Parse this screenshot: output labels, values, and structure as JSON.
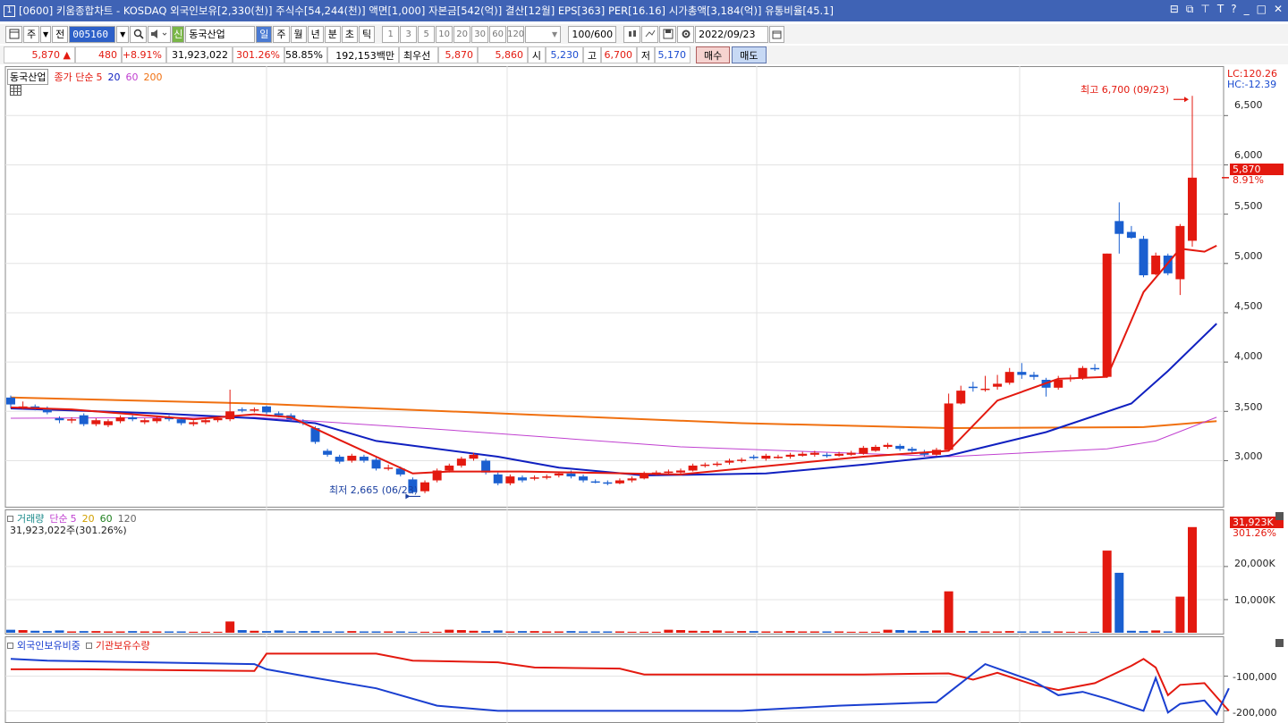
{
  "titlebar": {
    "window_number": "1",
    "text": "[0600] 키움종합차트 - KOSDAQ 외국인보유[2,330(천)] 주식수[54,244(천)] 액면[1,000] 자본금[542(억)] 결산[12월] EPS[363] PER[16.16] 시가총액[3,184(억)] 유통비율[45.1]",
    "controls": [
      "⊟",
      "⧉",
      "⊤",
      "T",
      "?",
      "_",
      "□",
      "✕"
    ]
  },
  "toolbar": {
    "period_type": "주",
    "all": "전",
    "stock_code": "005160",
    "shin": "신",
    "stock_name": "동국산업",
    "periods": [
      "일",
      "주",
      "월",
      "년",
      "분",
      "초",
      "틱"
    ],
    "active_period": "일",
    "intervals": [
      "1",
      "3",
      "5",
      "10",
      "20",
      "30",
      "60",
      "120"
    ],
    "counter": "100/600",
    "date": "2022/09/23"
  },
  "quote": {
    "price": "5,870",
    "arrow": "▲",
    "change": "480",
    "change_pct": "+8.91%",
    "volume": "31,923,022",
    "volume_ratio": "301.26%",
    "turnover_ratio": "58.85%",
    "amount": "192,153백만",
    "priority_label": "최우선",
    "ask": "5,870",
    "bid": "5,860",
    "open_label": "시",
    "open": "5,230",
    "high_label": "고",
    "high": "6,700",
    "low_label": "저",
    "low": "5,170",
    "buy_label": "매수",
    "sell_label": "매도"
  },
  "colors": {
    "up": "#e3190f",
    "down": "#1a5fd0",
    "ma5": "#e3190f",
    "ma20": "#1020c0",
    "ma60": "#c040d0",
    "ma200": "#f07010",
    "foreign": "#1a3fd0",
    "institution": "#e3190f"
  },
  "price_panel": {
    "stock_tag": "동국산업",
    "legend": {
      "label": "종가 단순",
      "p1": "5",
      "p2": "20",
      "p3": "60",
      "p4": "200"
    },
    "lc": "LC:120.26",
    "hc": "HC:-12.39",
    "high_annotation": "최고 6,700 (09/23)",
    "low_annotation": "최저 2,665 (06/23)",
    "current_price": "5,870",
    "current_pct": "8.91%",
    "y_ticks": [
      "6,500",
      "6,000",
      "5,500",
      "5,000",
      "4,500",
      "4,000",
      "3,500",
      "3,000"
    ]
  },
  "volume_panel": {
    "legend": {
      "label": "거래량",
      "ma_label": "단순",
      "p1": "5",
      "p2": "20",
      "p3": "60",
      "p4": "120"
    },
    "current_info": "31,923,022주(301.26%)",
    "current_tag": "31,923K",
    "current_pct": "301.26%",
    "y_ticks": [
      "20,000K",
      "10,000K"
    ]
  },
  "holding_panel": {
    "legend1": "외국인보유비중",
    "legend2": "기관보유수량",
    "y_ticks": [
      "-100,000",
      "-200,000"
    ]
  },
  "chart_data": {
    "type": "candlestick",
    "price_range": [
      2560,
      6820
    ],
    "candles": [
      [
        3640,
        3570,
        3660,
        3530,
        0
      ],
      [
        3545,
        3550,
        3600,
        3520,
        0
      ],
      [
        3550,
        3530,
        3570,
        3510,
        0
      ],
      [
        3530,
        3490,
        3550,
        3470,
        0
      ],
      [
        3430,
        3410,
        3450,
        3380,
        0
      ],
      [
        3410,
        3420,
        3440,
        3380,
        0
      ],
      [
        3460,
        3370,
        3480,
        3350,
        0
      ],
      [
        3370,
        3410,
        3430,
        3350,
        0
      ],
      [
        3360,
        3400,
        3420,
        3340,
        0
      ],
      [
        3400,
        3440,
        3460,
        3380,
        0
      ],
      [
        3440,
        3420,
        3460,
        3400,
        0
      ],
      [
        3390,
        3410,
        3430,
        3370,
        0
      ],
      [
        3400,
        3430,
        3450,
        3380,
        0
      ],
      [
        3440,
        3420,
        3460,
        3400,
        0
      ],
      [
        3420,
        3380,
        3440,
        3360,
        0
      ],
      [
        3370,
        3390,
        3410,
        3350,
        0
      ],
      [
        3390,
        3410,
        3430,
        3370,
        0
      ],
      [
        3410,
        3430,
        3450,
        3390,
        0
      ],
      [
        3420,
        3500,
        3720,
        3400,
        3.4
      ],
      [
        3520,
        3510,
        3540,
        3490,
        0
      ],
      [
        3510,
        3520,
        3540,
        3490,
        0
      ],
      [
        3550,
        3490,
        3560,
        3470,
        0
      ],
      [
        3480,
        3460,
        3500,
        3440,
        0
      ],
      [
        3460,
        3420,
        3480,
        3400,
        0
      ],
      [
        3400,
        3380,
        3420,
        3360,
        0
      ],
      [
        3330,
        3190,
        3350,
        3170,
        0
      ],
      [
        3100,
        3060,
        3120,
        3040,
        0
      ],
      [
        3040,
        2990,
        3060,
        2970,
        0
      ],
      [
        3000,
        3050,
        3070,
        2980,
        0
      ],
      [
        3040,
        3000,
        3060,
        2980,
        0
      ],
      [
        3010,
        2920,
        3030,
        2900,
        0
      ],
      [
        2920,
        2930,
        2960,
        2900,
        0
      ],
      [
        2920,
        2860,
        2940,
        2840,
        0
      ],
      [
        2810,
        2680,
        2830,
        2665,
        0
      ],
      [
        2690,
        2780,
        2800,
        2670,
        0
      ],
      [
        2800,
        2900,
        2920,
        2780,
        0
      ],
      [
        2900,
        2950,
        2970,
        2880,
        0
      ],
      [
        2950,
        3020,
        3040,
        2930,
        0
      ],
      [
        3020,
        3060,
        3080,
        3000,
        0
      ],
      [
        3000,
        2880,
        3020,
        2860,
        0
      ],
      [
        2860,
        2770,
        2880,
        2750,
        0
      ],
      [
        2770,
        2840,
        2860,
        2750,
        0
      ],
      [
        2830,
        2800,
        2850,
        2780,
        0
      ],
      [
        2820,
        2830,
        2850,
        2800,
        0
      ],
      [
        2830,
        2840,
        2860,
        2810,
        0
      ],
      [
        2850,
        2870,
        2890,
        2830,
        0
      ],
      [
        2870,
        2840,
        2900,
        2820,
        0
      ],
      [
        2840,
        2800,
        2860,
        2780,
        0
      ],
      [
        2790,
        2780,
        2810,
        2770,
        0
      ],
      [
        2780,
        2770,
        2800,
        2750,
        0
      ],
      [
        2770,
        2800,
        2820,
        2760,
        0
      ],
      [
        2800,
        2820,
        2840,
        2780,
        0
      ],
      [
        2820,
        2870,
        2890,
        2810,
        0
      ],
      [
        2870,
        2880,
        2900,
        2850,
        0
      ],
      [
        2880,
        2890,
        2910,
        2860,
        0
      ],
      [
        2880,
        2900,
        2920,
        2860,
        0
      ],
      [
        2900,
        2950,
        2970,
        2890,
        0
      ],
      [
        2950,
        2960,
        2980,
        2930,
        0
      ],
      [
        2960,
        2970,
        2990,
        2940,
        0
      ],
      [
        2980,
        3000,
        3020,
        2960,
        0
      ],
      [
        3000,
        3010,
        3030,
        2980,
        0
      ],
      [
        3040,
        3030,
        3060,
        3010,
        0
      ],
      [
        3020,
        3050,
        3070,
        3000,
        0
      ],
      [
        3030,
        3040,
        3060,
        3020,
        0
      ],
      [
        3040,
        3060,
        3080,
        3020,
        0
      ],
      [
        3050,
        3070,
        3090,
        3040,
        0
      ],
      [
        3060,
        3080,
        3100,
        3040,
        0
      ],
      [
        3060,
        3050,
        3080,
        3030,
        0
      ],
      [
        3050,
        3070,
        3090,
        3040,
        0
      ],
      [
        3060,
        3080,
        3100,
        3050,
        0
      ],
      [
        3070,
        3130,
        3150,
        3060,
        0
      ],
      [
        3100,
        3140,
        3160,
        3090,
        0
      ],
      [
        3140,
        3160,
        3180,
        3120,
        0
      ],
      [
        3150,
        3120,
        3170,
        3100,
        0
      ],
      [
        3120,
        3100,
        3140,
        3080,
        0
      ],
      [
        3090,
        3060,
        3110,
        3040,
        0
      ],
      [
        3060,
        3110,
        3130,
        3050,
        0
      ],
      [
        3110,
        3580,
        3680,
        3100,
        12.5
      ],
      [
        3580,
        3710,
        3760,
        3570,
        0
      ],
      [
        3750,
        3740,
        3800,
        3700,
        0
      ],
      [
        3730,
        3730,
        3860,
        3700,
        0
      ],
      [
        3750,
        3780,
        3870,
        3720,
        0
      ],
      [
        3790,
        3900,
        3940,
        3770,
        0
      ],
      [
        3900,
        3870,
        3990,
        3830,
        0
      ],
      [
        3870,
        3850,
        3900,
        3820,
        0
      ],
      [
        3820,
        3740,
        3840,
        3650,
        0
      ],
      [
        3740,
        3820,
        3860,
        3720,
        0
      ],
      [
        3830,
        3840,
        3870,
        3800,
        0
      ],
      [
        3840,
        3940,
        3960,
        3820,
        0
      ],
      [
        3940,
        3930,
        3980,
        3910,
        0
      ],
      [
        3850,
        5100,
        5100,
        3840,
        24.8
      ],
      [
        5430,
        5300,
        5620,
        5100,
        18.1
      ],
      [
        5320,
        5260,
        5380,
        5250,
        0
      ],
      [
        5250,
        4880,
        5280,
        4860,
        0
      ],
      [
        4890,
        5080,
        5110,
        4880,
        0
      ],
      [
        5080,
        4900,
        5100,
        4880,
        0
      ],
      [
        4840,
        5380,
        5400,
        4680,
        10.9
      ],
      [
        5230,
        5870,
        6700,
        5170,
        31.9
      ]
    ],
    "volume_small": [
      0.9,
      0.8,
      0.6,
      0.5,
      0.7,
      0.4,
      0.5,
      0.5,
      0.4,
      0.4,
      0.5,
      0.4,
      0.4,
      0.4,
      0.4,
      0.3,
      0.3,
      0.3
    ],
    "ma5": [
      [
        0,
        3540
      ],
      [
        5,
        3520
      ],
      [
        15,
        3420
      ],
      [
        20,
        3470
      ],
      [
        23,
        3440
      ],
      [
        27,
        3210
      ],
      [
        33,
        2870
      ],
      [
        36,
        2890
      ],
      [
        42,
        2890
      ],
      [
        55,
        2860
      ],
      [
        70,
        3040
      ],
      [
        77,
        3100
      ],
      [
        81,
        3610
      ],
      [
        86,
        3830
      ],
      [
        90,
        3850
      ],
      [
        93,
        4710
      ],
      [
        96,
        5150
      ],
      [
        98,
        5120
      ],
      [
        99,
        5180
      ]
    ],
    "ma20": [
      [
        0,
        3530
      ],
      [
        12,
        3480
      ],
      [
        20,
        3430
      ],
      [
        25,
        3380
      ],
      [
        30,
        3200
      ],
      [
        40,
        3040
      ],
      [
        45,
        2930
      ],
      [
        52,
        2850
      ],
      [
        62,
        2870
      ],
      [
        70,
        2960
      ],
      [
        77,
        3050
      ],
      [
        85,
        3290
      ],
      [
        92,
        3580
      ],
      [
        95,
        3910
      ],
      [
        99,
        4390
      ]
    ],
    "ma60": [
      [
        0,
        3430
      ],
      [
        20,
        3440
      ],
      [
        35,
        3320
      ],
      [
        55,
        3140
      ],
      [
        77,
        3040
      ],
      [
        90,
        3120
      ],
      [
        94,
        3200
      ],
      [
        99,
        3440
      ]
    ],
    "ma200": [
      [
        0,
        3640
      ],
      [
        20,
        3580
      ],
      [
        40,
        3480
      ],
      [
        60,
        3380
      ],
      [
        77,
        3330
      ],
      [
        93,
        3340
      ],
      [
        99,
        3400
      ]
    ],
    "foreign_ratio": [
      [
        0,
        -50000
      ],
      [
        3,
        -55000
      ],
      [
        20,
        -65000
      ],
      [
        21,
        -80000
      ],
      [
        25,
        -105000
      ],
      [
        30,
        -135000
      ],
      [
        35,
        -185000
      ],
      [
        40,
        -200000
      ],
      [
        45,
        -200000
      ],
      [
        50,
        -200000
      ],
      [
        60,
        -200000
      ],
      [
        68,
        -185000
      ],
      [
        76,
        -175000
      ],
      [
        80,
        -65000
      ],
      [
        84,
        -115000
      ],
      [
        86,
        -155000
      ],
      [
        88,
        -145000
      ],
      [
        90,
        -165000
      ],
      [
        93,
        -200000
      ],
      [
        94,
        -105000
      ],
      [
        95,
        -205000
      ],
      [
        96,
        -180000
      ],
      [
        98,
        -170000
      ],
      [
        99,
        -210000
      ],
      [
        100,
        -135000
      ]
    ],
    "institution_qty": [
      [
        0,
        -80000
      ],
      [
        6,
        -80000
      ],
      [
        20,
        -85000
      ],
      [
        21,
        -35000
      ],
      [
        30,
        -35000
      ],
      [
        33,
        -55000
      ],
      [
        40,
        -60000
      ],
      [
        43,
        -75000
      ],
      [
        50,
        -78000
      ],
      [
        52,
        -95000
      ],
      [
        70,
        -95000
      ],
      [
        77,
        -92000
      ],
      [
        79,
        -110000
      ],
      [
        81,
        -90000
      ],
      [
        84,
        -125000
      ],
      [
        86,
        -140000
      ],
      [
        89,
        -120000
      ],
      [
        92,
        -70000
      ],
      [
        93,
        -50000
      ],
      [
        94,
        -75000
      ],
      [
        95,
        -155000
      ],
      [
        96,
        -125000
      ],
      [
        98,
        -120000
      ],
      [
        99,
        -160000
      ],
      [
        100,
        -200000
      ]
    ]
  }
}
